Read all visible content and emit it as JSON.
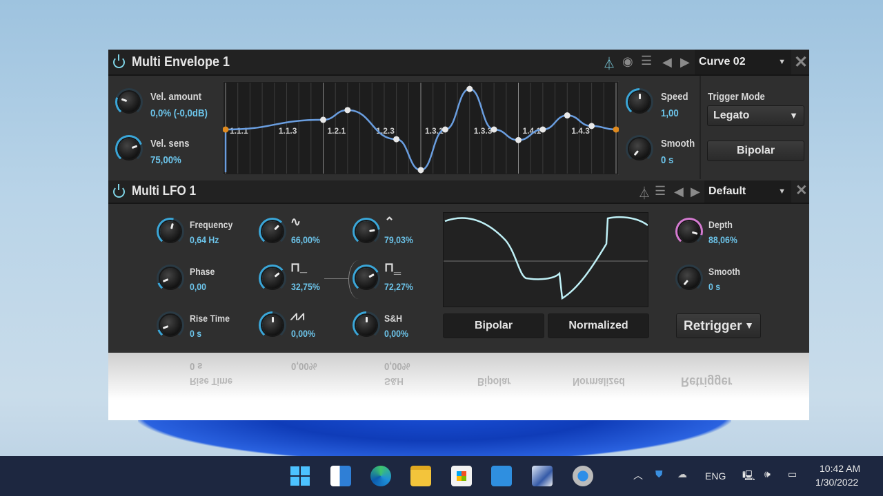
{
  "envelope": {
    "title": "Multi Envelope 1",
    "preset": "Curve 02",
    "vel_amount": {
      "label": "Vel. amount",
      "value": "0,0% (-0,0dB)",
      "level": 0.25
    },
    "vel_sens": {
      "label": "Vel. sens",
      "value": "75,00%",
      "level": 0.75
    },
    "speed": {
      "label": "Speed",
      "value": "1,00",
      "level": 0.5
    },
    "smooth": {
      "label": "Smooth",
      "value": "0 s",
      "level": 0.0
    },
    "trigger_mode_label": "Trigger Mode",
    "trigger_mode": "Legato",
    "bipolar": "Bipolar",
    "grid_labels": [
      "1.1.1",
      "1.1.3",
      "1.2.1",
      "1.2.3",
      "1.3.1",
      "1.3.3",
      "1.4.1",
      "1.4.3"
    ],
    "points": [
      [
        0,
        0.5
      ],
      [
        1.0,
        0.61
      ],
      [
        1.25,
        0.72
      ],
      [
        1.75,
        0.39
      ],
      [
        2.0,
        0.04
      ],
      [
        2.25,
        0.5
      ],
      [
        2.5,
        0.96
      ],
      [
        2.75,
        0.5
      ],
      [
        3.0,
        0.38
      ],
      [
        3.25,
        0.5
      ],
      [
        3.5,
        0.66
      ],
      [
        3.75,
        0.54
      ],
      [
        4.0,
        0.5
      ]
    ],
    "curve_color": "#6a9ee0",
    "endpoint_color": "#e08a1e"
  },
  "lfo": {
    "title": "Multi LFO 1",
    "preset": "Default",
    "frequency": {
      "label": "Frequency",
      "value": "0,64 Hz",
      "level": 0.55
    },
    "phase": {
      "label": "Phase",
      "value": "0,00",
      "level": 0.1
    },
    "rise_time": {
      "label": "Rise Time",
      "value": "0 s",
      "level": 0.1
    },
    "sine": {
      "value": "66,00%",
      "level": 0.66
    },
    "square": {
      "value": "32,75%",
      "level": 0.68
    },
    "saw": {
      "value": "0,00%",
      "level": 0.5
    },
    "triangle": {
      "value": "79,03%",
      "level": 0.79
    },
    "pulse": {
      "value": "72,27%",
      "level": 0.72
    },
    "sh": {
      "label": "S&H",
      "value": "0,00%",
      "level": 0.5
    },
    "depth": {
      "label": "Depth",
      "value": "88,06%",
      "level": 0.88
    },
    "smooth": {
      "label": "Smooth",
      "value": "0 s",
      "level": 0.0
    },
    "bipolar": "Bipolar",
    "normalized": "Normalized",
    "retrigger": "Retrigger"
  },
  "taskbar": {
    "lang": "ENG",
    "time": "10:42 AM",
    "date": "1/30/2022"
  }
}
